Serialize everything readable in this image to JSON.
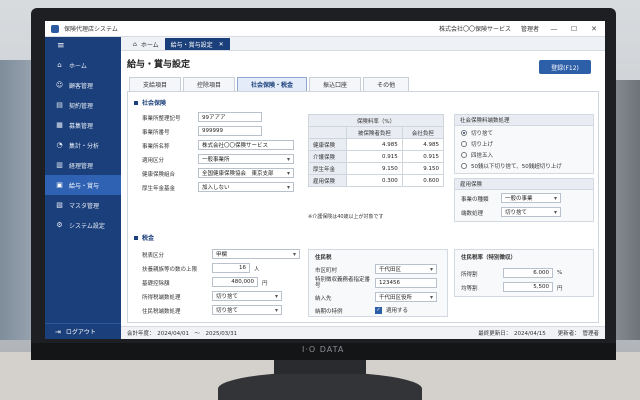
{
  "window": {
    "title": "保険代理店システム",
    "company": "株式会社〇〇保険サービス",
    "user": "管理者"
  },
  "sidebar": {
    "items": [
      {
        "icon": "home-icon",
        "glyph": "⌂",
        "label": "ホーム"
      },
      {
        "icon": "customer-icon",
        "glyph": "☺",
        "label": "顧客管理"
      },
      {
        "icon": "contract-icon",
        "glyph": "▤",
        "label": "契約管理"
      },
      {
        "icon": "recruit-icon",
        "glyph": "▦",
        "label": "募集管理"
      },
      {
        "icon": "analysis-icon",
        "glyph": "◔",
        "label": "集計・分析"
      },
      {
        "icon": "accounting-icon",
        "glyph": "▥",
        "label": "経理管理"
      },
      {
        "icon": "payroll-icon",
        "glyph": "▣",
        "label": "給与・賞与"
      },
      {
        "icon": "master-icon",
        "glyph": "▧",
        "label": "マスタ管理"
      },
      {
        "icon": "settings-icon",
        "glyph": "⚙",
        "label": "システム設定"
      }
    ],
    "active_index": 6,
    "logout": "ログアウト"
  },
  "tabs": {
    "home": "ホーム",
    "current": "給与・賞与設定"
  },
  "page": {
    "title": "給与・賞与設定",
    "register_button": "登録(F12)"
  },
  "subtabs": [
    "支給項目",
    "控除項目",
    "社会保険・税金",
    "振込口座",
    "その他"
  ],
  "active_subtab": 2,
  "social": {
    "heading": "社会保険",
    "fields": [
      {
        "label": "事業所整理記号",
        "value": "99アアア",
        "select": false
      },
      {
        "label": "事業所番号",
        "value": "999999",
        "select": false
      },
      {
        "label": "事業所名称",
        "value": "株式会社〇〇保険サービス",
        "select": false
      },
      {
        "label": "適用区分",
        "value": "一般事業所",
        "select": true
      },
      {
        "label": "健康保険組合",
        "value": "全国健康保険協会　東京支部",
        "select": true
      },
      {
        "label": "厚生年金基金",
        "value": "加入しない",
        "select": true
      }
    ]
  },
  "rates": {
    "title": "保険料率（%）",
    "col_employee": "被保険者負担",
    "col_company": "会社負担",
    "rows": [
      {
        "label": "健康保険",
        "employee": "4.985",
        "company": "4.985"
      },
      {
        "label": "介護保険",
        "employee": "0.915",
        "company": "0.915"
      },
      {
        "label": "厚生年金",
        "employee": "9.150",
        "company": "9.150"
      },
      {
        "label": "雇用保険",
        "employee": "0.300",
        "company": "0.600"
      }
    ],
    "note": "※介護保険は40歳以上が対象です"
  },
  "rounding": {
    "title": "社会保険料端数処理",
    "options": [
      "切り捨て",
      "切り上げ",
      "四捨五入",
      "50銭以下切り捨て、50銭超切り上げ"
    ],
    "selected": 0
  },
  "employment": {
    "title": "雇用保険",
    "business_label": "事業の種類",
    "business_value": "一般の事業",
    "fraction_label": "端数処理",
    "fraction_value": "切り捨て"
  },
  "tax": {
    "heading": "税金",
    "tax_class_label": "税表区分",
    "tax_class_value": "甲欄",
    "dependents_label": "扶養親族等の数の上限",
    "dependents_value": "16",
    "dependents_unit": "人",
    "basic_label": "基礎控除額",
    "basic_value": "480,000",
    "basic_unit": "円",
    "income_round_label": "所得税端数処理",
    "income_round_value": "切り捨て",
    "resident_round_label": "住民税端数処理",
    "resident_round_value": "切り捨て"
  },
  "resident": {
    "title": "住民税",
    "city_label": "市区町村",
    "city_value": "千代田区",
    "special_label": "特別徴収義務者指定番号",
    "special_value": "123456",
    "payto_label": "納入先",
    "payto_value": "千代田区役所",
    "exception_label": "納期の特例",
    "exception_check": "適用する"
  },
  "special_rates": {
    "title": "住民税率（特別徴収）",
    "income_label": "所得割",
    "income_value": "6.000",
    "income_unit": "%",
    "equal_label": "均等割",
    "equal_value": "5,500",
    "equal_unit": "円"
  },
  "status": {
    "fiscal": "会計年度：　2024/04/01　～　2025/03/31",
    "updated": "最終更新日：　2024/04/15",
    "updater": "更新者：　管理者"
  }
}
